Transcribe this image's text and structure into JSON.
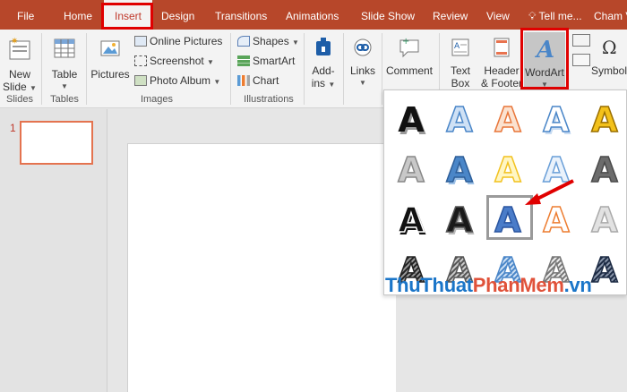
{
  "tabs": [
    "File",
    "Home",
    "Insert",
    "Design",
    "Transitions",
    "Animations",
    "Slide Show",
    "Review",
    "View"
  ],
  "active_tab": "Insert",
  "tell_me": "Tell me...",
  "user": "Cham V",
  "ribbon": {
    "slides": {
      "new_slide_line1": "New",
      "new_slide_line2": "Slide",
      "group": "Slides"
    },
    "tables": {
      "table": "Table",
      "group": "Tables"
    },
    "images": {
      "pictures": "Pictures",
      "online_pictures": "Online Pictures",
      "screenshot": "Screenshot",
      "photo_album": "Photo Album",
      "group": "Images"
    },
    "illustrations": {
      "shapes": "Shapes",
      "smartart": "SmartArt",
      "chart": "Chart",
      "group": "Illustrations"
    },
    "addins": {
      "line1": "Add-",
      "line2": "ins"
    },
    "links": {
      "label": "Links"
    },
    "comment": {
      "label": "Comment"
    },
    "textbox": {
      "line1": "Text",
      "line2": "Box"
    },
    "header_footer": {
      "line1": "Header",
      "line2": "& Footer"
    },
    "wordart": {
      "label": "WordArt"
    },
    "symbols": {
      "label": "Symbol"
    }
  },
  "slide_number": "1",
  "gallery": {
    "letter": "A",
    "styles": [
      "black-shadow",
      "blue-outline-light",
      "orange-gradient-outline",
      "blue-outline-glow",
      "gold-bevel",
      "gray-soft",
      "blue-gradient-solid",
      "yellow-outline",
      "light-blue-outline",
      "gray-gradient",
      "black-white-outline",
      "black-heavy",
      "blue-selected",
      "orange-outline-white",
      "silver-soft",
      "black-striped",
      "gray-striped",
      "blue-striped",
      "gray-light-striped",
      "dark-blue-striped"
    ],
    "selected_index": 12
  },
  "watermark": {
    "part1": "ThuThuat",
    "part2": "PhanMem",
    "part3": ".vn"
  },
  "colors": {
    "accent": "#b7472a",
    "highlight": "#e00000",
    "wordart_blue": "#3d7fc8"
  }
}
